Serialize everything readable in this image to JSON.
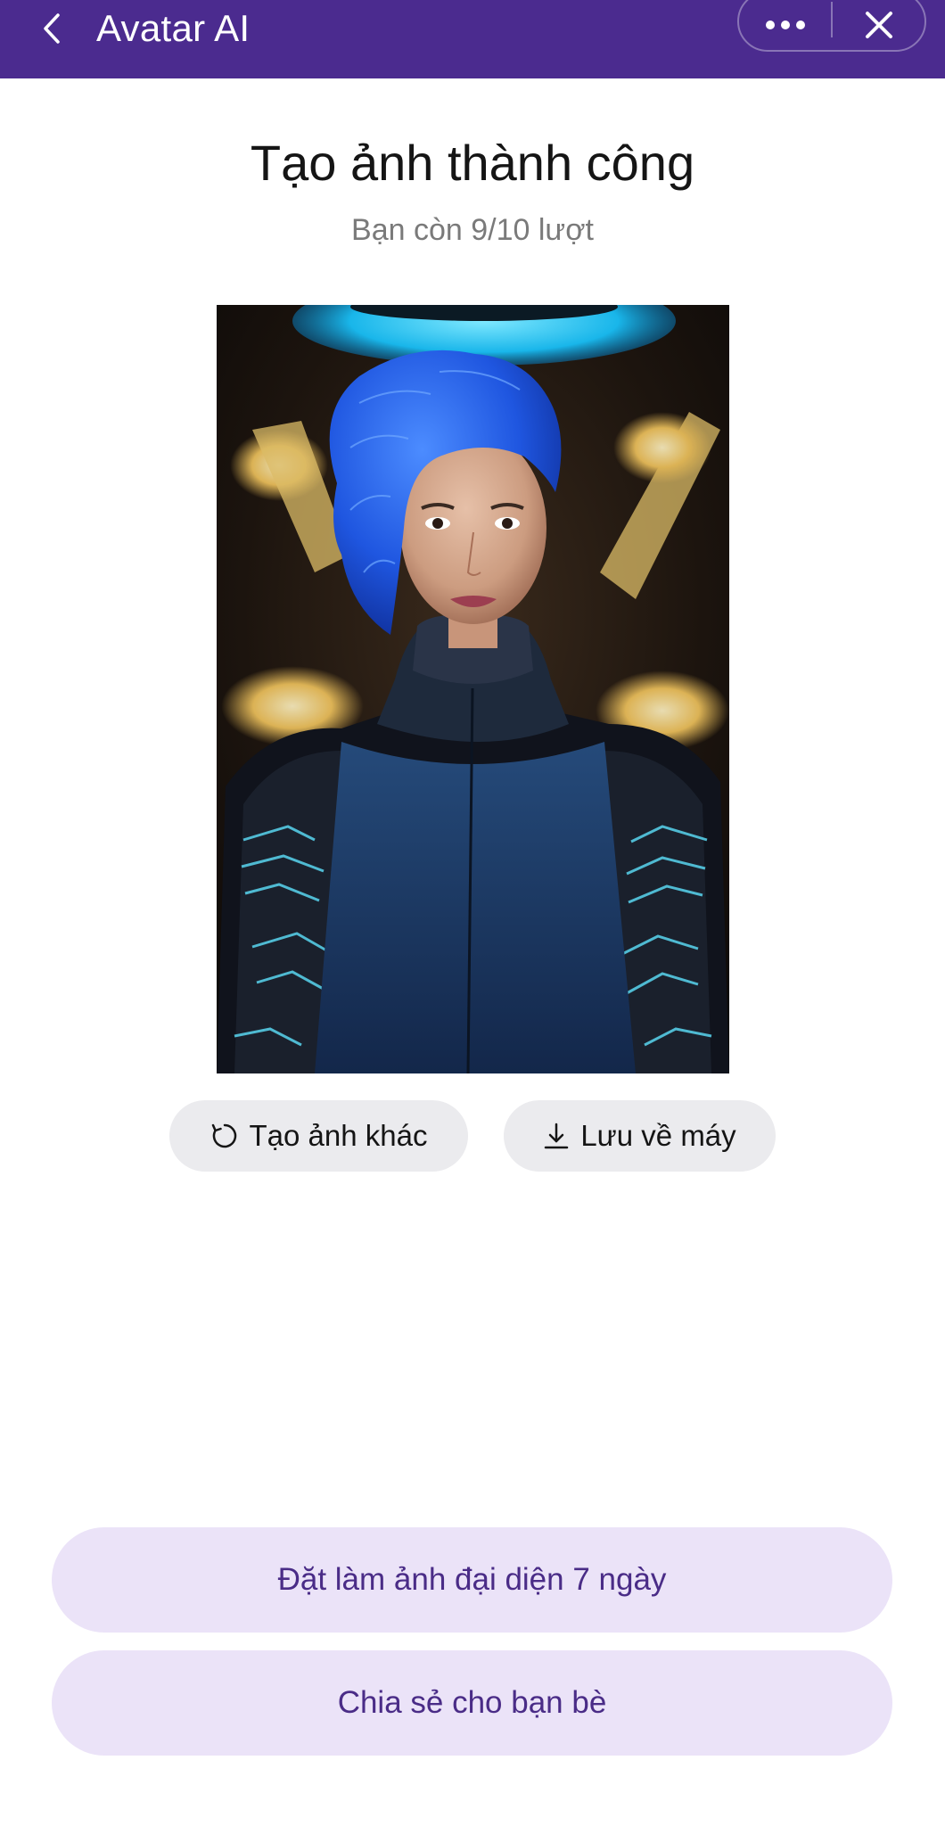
{
  "header": {
    "title": "Avatar AI",
    "back_icon": "chevron-left-icon",
    "more_icon": "more-dots-icon",
    "close_icon": "close-icon",
    "background_color": "#4b2b8f"
  },
  "main": {
    "title": "Tạo ảnh thành công",
    "subtitle": "Bạn còn 9/10 lượt",
    "image_description": "AI-generated portrait of a woman with blue hair in a futuristic suit"
  },
  "actions": {
    "regenerate_label": "Tạo ảnh khác",
    "regenerate_icon": "refresh-icon",
    "save_label": "Lưu về máy",
    "save_icon": "download-icon"
  },
  "bottom": {
    "set_avatar_label": "Đặt làm ảnh đại diện 7 ngày",
    "share_label": "Chia sẻ cho bạn bè",
    "button_color": "#ebe3f8",
    "text_color": "#4a2c87"
  }
}
